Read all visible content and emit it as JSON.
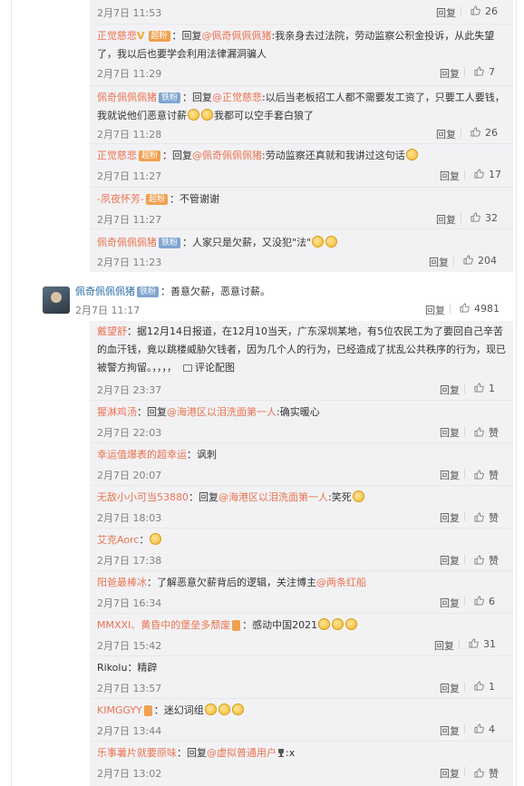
{
  "labels": {
    "reply": "回复",
    "like_empty": "赞"
  },
  "top_replies": [
    {
      "time": "2月7日 11:53",
      "likes": "26"
    },
    {
      "user": "正觉慈悲",
      "vip": "V",
      "badge": "超粉",
      "prefix": "：回复",
      "mention": "@佩奇佩佩佩猪",
      "text": ":我亲身去过法院，劳动监察公积金投诉，从此失望了，我以后也要学会利用法律漏洞骗人",
      "time": "2月7日 11:29",
      "likes": "7"
    },
    {
      "user": "佩奇佩佩佩猪",
      "badge": "铁粉",
      "prefix": "：回复",
      "mention": "@正觉慈悲",
      "text": ":以后当老板招工人都不需要发工资了，只要工人要钱，我就说他们恶意讨薪",
      "text2": "我都可以空手套白狼了",
      "time": "2月7日 11:28",
      "likes": "26"
    },
    {
      "user": "正觉慈悲",
      "badge": "超粉",
      "prefix": "：回复",
      "mention": "@佩奇佩佩佩猪",
      "text": ":劳动监察还真就和我讲过这句话",
      "time": "2月7日 11:27",
      "likes": "17"
    },
    {
      "user": "-夙夜怀芳-",
      "badge": "超粉",
      "text": "：不管谢谢",
      "time": "2月7日 11:27",
      "likes": "32"
    },
    {
      "user": "佩奇佩佩佩猪",
      "badge": "铁粉",
      "text": "：人家只是欠薪，又没犯\"法\"",
      "time": "2月7日 11:23",
      "likes": "204"
    }
  ],
  "main_comment": {
    "user": "佩奇佩佩佩猪",
    "badge": "铁粉",
    "text": "：善意欠薪，恶意讨薪。",
    "time": "2月7日 11:17",
    "likes": "4981"
  },
  "sub_replies": [
    {
      "user": "戴望舒",
      "text": "：据12月14日报道，在12月10当天，广东深圳某地，有5位农民工为了要回自己辛苦的血汗钱，竟以跳楼威胁欠钱者，因为几个人的行为，已经造成了扰乱公共秩序的行为，现已被警方拘留。，，，，",
      "pic_link": "评论配图",
      "time": "2月7日 23:37",
      "likes": "1"
    },
    {
      "user": "猩淋鸡汤",
      "prefix": "：回复",
      "mention": "@海港区以泪洗面第一人",
      "text": ":确实暖心",
      "time": "2月7日 22:03",
      "likes": "赞"
    },
    {
      "user": "幸运值爆表的超幸运",
      "text": "：讽刺",
      "time": "2月7日 20:07",
      "likes": "赞"
    },
    {
      "user": "无敌小小可当53880",
      "prefix": "：回复",
      "mention": "@海港区以泪洗面第一人",
      "text": ":笑死",
      "time": "2月7日 18:03",
      "likes": "赞"
    },
    {
      "user": "艾克Aorc",
      "text": "：",
      "time": "2月7日 17:38",
      "likes": "赞"
    },
    {
      "user": "阳爸最棒冰",
      "text": "：了解恶意欠薪背后的逻辑，关注博主",
      "mention": "@两条红船",
      "time": "2月7日 16:34",
      "likes": "6"
    },
    {
      "user": "MMXXI、黄昏中的堡垒多颓废",
      "text": "：感动中国2021",
      "time": "2月7日 15:42",
      "likes": "31"
    },
    {
      "user": "Rikolu",
      "text": "：精辟",
      "time": "2月7日 13:57",
      "likes": "1"
    },
    {
      "user": "KIMGGYY",
      "text": "：迷幻词组",
      "time": "2月7日 13:44",
      "likes": "4"
    },
    {
      "user": "乐事薯片就要原味",
      "prefix": "：回复",
      "mention": "@虚拟普通用户",
      "text": ":x",
      "time": "2月7日 13:02",
      "likes": "赞"
    }
  ]
}
